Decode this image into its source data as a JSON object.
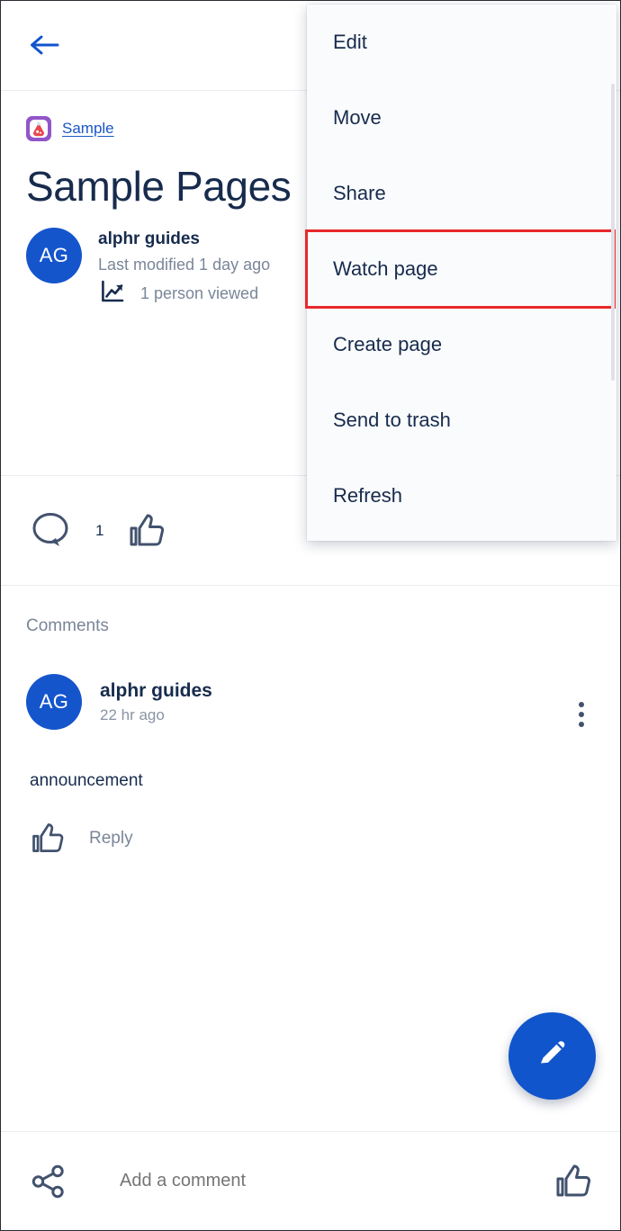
{
  "header": {
    "back_icon": "arrow-left-icon"
  },
  "page": {
    "space_icon": "flask-emoji-icon",
    "space_name": "Sample",
    "title": "Sample Pages",
    "author_initials": "AG",
    "author_name": "alphr guides",
    "last_modified": "Last modified 1 day ago",
    "views_icon": "trending-up-icon",
    "views_text": "1 person viewed"
  },
  "actions": {
    "comment_icon": "comment-bubble-icon",
    "comment_count": "1",
    "like_icon": "thumbs-up-icon"
  },
  "comments": {
    "heading": "Comments",
    "items": [
      {
        "initials": "AG",
        "author": "alphr guides",
        "time": "22 hr ago",
        "body": "announcement",
        "like_icon": "thumbs-up-icon",
        "reply_label": "Reply",
        "more_icon": "more-vertical-icon"
      }
    ]
  },
  "fab": {
    "icon": "pencil-icon"
  },
  "bottom_bar": {
    "share_icon": "share-nodes-icon",
    "comment_placeholder": "Add a comment",
    "like_icon": "thumbs-up-icon"
  },
  "menu": {
    "items": [
      {
        "label": "Edit",
        "highlighted": false
      },
      {
        "label": "Move",
        "highlighted": false
      },
      {
        "label": "Share",
        "highlighted": false
      },
      {
        "label": "Watch page",
        "highlighted": true
      },
      {
        "label": "Create page",
        "highlighted": false
      },
      {
        "label": "Send to trash",
        "highlighted": false
      },
      {
        "label": "Refresh",
        "highlighted": false
      }
    ]
  },
  "colors": {
    "brand_blue": "#1155cc",
    "link_blue": "#1a56c4",
    "text_dark": "#172b4d",
    "text_muted": "#7a8699",
    "highlight_red": "#e8282a",
    "menu_bg": "#fafbfc"
  }
}
